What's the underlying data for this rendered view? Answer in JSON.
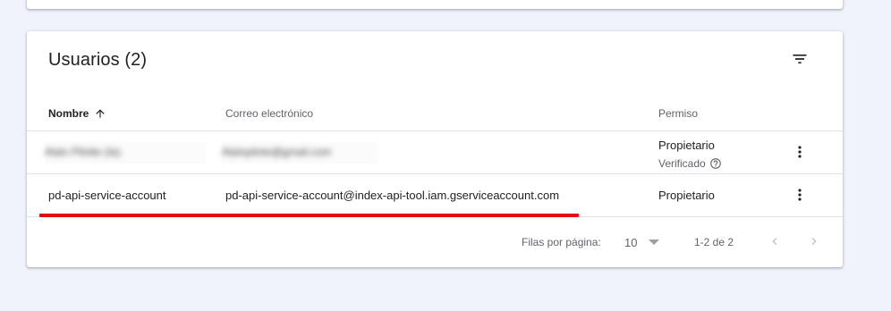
{
  "card": {
    "title": "Usuarios (2)",
    "columns": {
      "name": "Nombre",
      "email": "Correo electrónico",
      "permission": "Permiso"
    },
    "rows": [
      {
        "name": "Alain Pilotte (Ia)",
        "email": "Alainpilote@gmail.com",
        "permission": "Propietario",
        "status": "Verificado"
      },
      {
        "name": "pd-api-service-account",
        "email": "pd-api-service-account@index-api-tool.iam.gserviceaccount.com",
        "permission": "Propietario"
      }
    ]
  },
  "pagination": {
    "rows_per_page_label": "Filas por página:",
    "rows_per_page_value": "10",
    "range": "1-2 de 2"
  },
  "colors": {
    "highlight_underline": "#e50914",
    "background": "#f1f3fc"
  },
  "icons": [
    "filter-list-icon",
    "arrow-upward-icon",
    "more-vert-icon",
    "help-outline-icon",
    "arrow-drop-down-icon",
    "chevron-left-icon",
    "chevron-right-icon"
  ]
}
